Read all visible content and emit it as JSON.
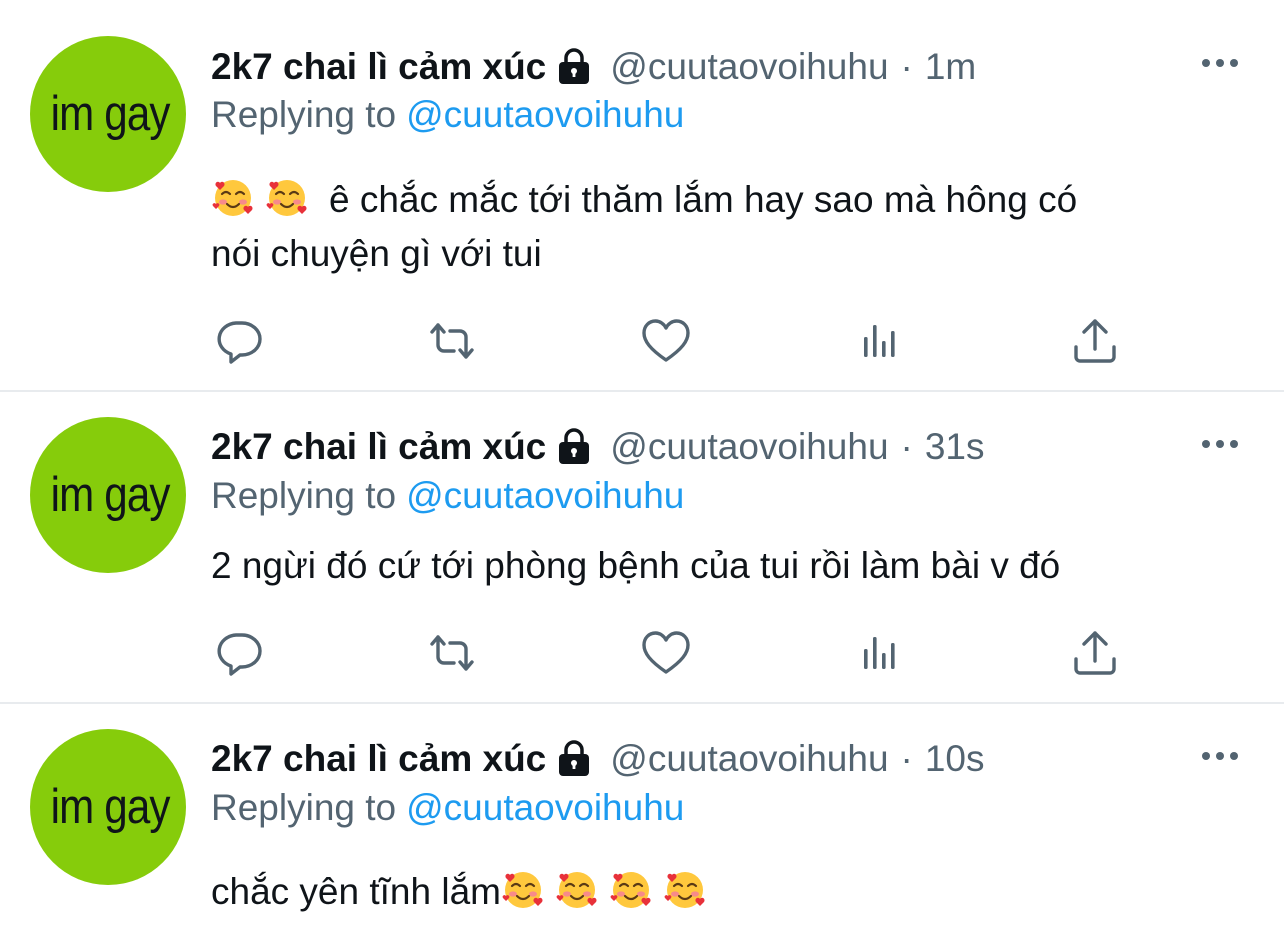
{
  "tweets": [
    {
      "avatar_text": "im gay",
      "display_name": "2k7 chai lì cảm xúc",
      "handle": "@cuutaovoihuhu",
      "separator": "·",
      "time": "1m",
      "replying_prefix": "Replying to",
      "replying_handle": "@cuutaovoihuhu",
      "line1_text": "ê chắc mắc tới thăm lắm hay sao mà hông có",
      "line2_text": "nói chuyện gì với tui",
      "emoji_count": 2
    },
    {
      "avatar_text": "im gay",
      "display_name": "2k7 chai lì cảm xúc",
      "handle": "@cuutaovoihuhu",
      "separator": "·",
      "time": "31s",
      "replying_prefix": "Replying to",
      "replying_handle": "@cuutaovoihuhu",
      "text": "2 ngừi đó cứ tới phòng bệnh của tui rồi làm bài v đó"
    },
    {
      "avatar_text": "im gay",
      "display_name": "2k7 chai lì cảm xúc",
      "handle": "@cuutaovoihuhu",
      "separator": "·",
      "time": "10s",
      "replying_prefix": "Replying to",
      "replying_handle": "@cuutaovoihuhu",
      "text": "chắc yên tĩnh lắm",
      "emoji_count": 4
    }
  ],
  "icons": {
    "lock": "lock-icon",
    "more": "more-options-icon",
    "reply": "reply-icon",
    "retweet": "retweet-icon",
    "like": "like-icon",
    "analytics": "analytics-icon",
    "share": "share-icon",
    "emoji": "smiling-face-with-hearts"
  },
  "colors": {
    "text_primary": "#0f1419",
    "text_secondary": "#536471",
    "link": "#1d9bf0",
    "avatar_bg": "#86cc0b",
    "divider": "#e8ebee"
  }
}
